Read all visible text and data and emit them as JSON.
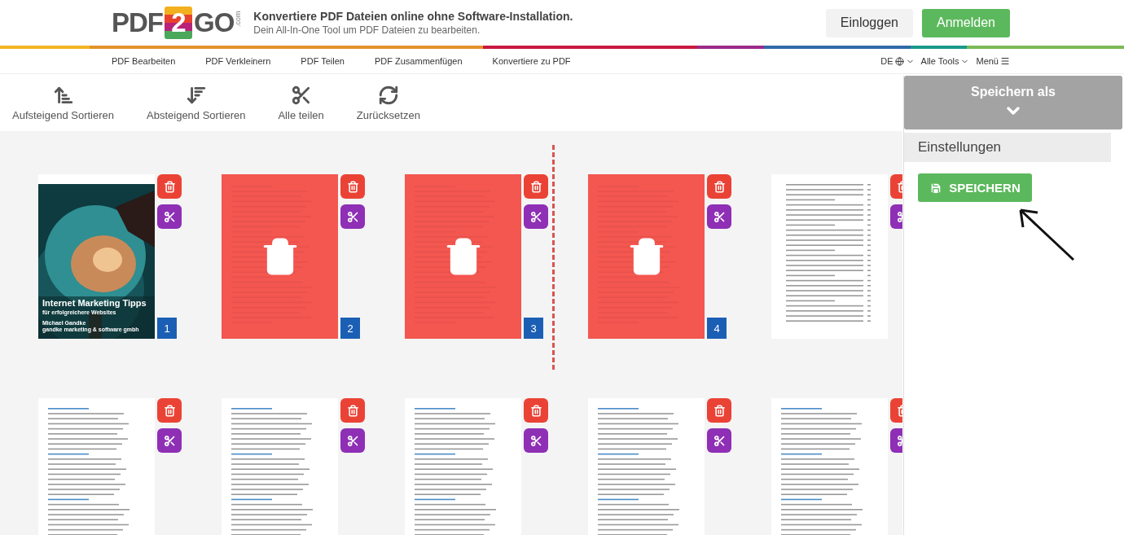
{
  "header": {
    "logo": {
      "left": "PDF",
      "middle": "2",
      "right": "GO",
      "suffix": ".com"
    },
    "tagline": "Konvertiere PDF Dateien online ohne Software-Installation.",
    "subtitle": "Dein All-In-One Tool um PDF Dateien zu bearbeiten.",
    "buttons": [
      {
        "label": "Einloggen",
        "kind": "secondary"
      },
      {
        "label": "Anmelden",
        "kind": "primary"
      }
    ]
  },
  "nav": {
    "items": [
      "PDF Bearbeiten",
      "PDF Verkleinern",
      "PDF Teilen",
      "PDF Zusammenfügen",
      "Konvertiere zu PDF"
    ],
    "right": [
      {
        "label": "DE",
        "kind": "language"
      },
      {
        "label": "Alle Tools",
        "kind": "dropdown"
      },
      {
        "label": "Menü",
        "kind": "menu"
      }
    ]
  },
  "toolbar": [
    {
      "label": "Aufsteigend Sortieren",
      "kind": "sort-asc"
    },
    {
      "label": "Absteigend Sortieren",
      "kind": "sort-desc"
    },
    {
      "label": "Alle teilen",
      "kind": "split"
    },
    {
      "label": "Zurücksetzen",
      "kind": "reset"
    }
  ],
  "pages": [
    {
      "number": "1",
      "kind": "cover",
      "deleted": false,
      "split_after": false,
      "cover": {
        "title": "Internet Marketing Tipps",
        "subtitle": "für erfolgreichere Websites",
        "author": "Michael Gandke",
        "company": "gandke marketing & software gmbh"
      }
    },
    {
      "number": "2",
      "kind": "text",
      "deleted": true,
      "split_after": false
    },
    {
      "number": "3",
      "kind": "text",
      "deleted": true,
      "split_after": true
    },
    {
      "number": "4",
      "kind": "text",
      "deleted": true,
      "split_after": false
    },
    {
      "kind": "toc",
      "deleted": false,
      "split_after": false
    },
    {
      "kind": "text",
      "deleted": false,
      "split_after": false
    },
    {
      "kind": "text",
      "deleted": false,
      "split_after": false
    },
    {
      "kind": "text",
      "deleted": false,
      "split_after": false
    },
    {
      "kind": "text",
      "deleted": false,
      "split_after": false
    },
    {
      "kind": "text",
      "deleted": false,
      "split_after": false
    }
  ],
  "panel": {
    "title": "Speichern als",
    "section": "Einstellungen",
    "button": "SPEICHERN",
    "pointer_arrow": true
  }
}
